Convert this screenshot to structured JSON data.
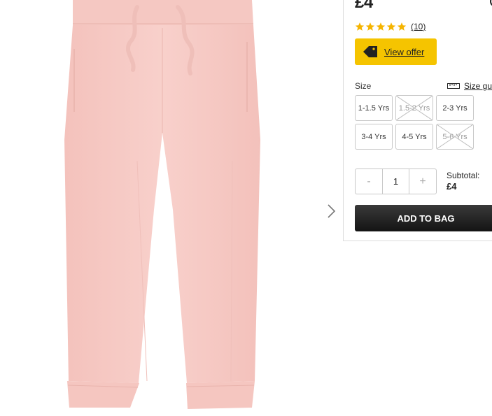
{
  "product": {
    "image_alt": "pink jogger trousers",
    "image_color": "#f6c8c3"
  },
  "panel": {
    "price": "£4",
    "rating": {
      "stars": 5,
      "review_count": "(10)"
    },
    "offer_button": {
      "label": "View offer",
      "color": "#f5c400"
    },
    "size_label": "Size",
    "size_guide_label": "Size guide",
    "sizes": [
      {
        "label": "1-1.5 Yrs",
        "available": true
      },
      {
        "label": "1.5-2 Yrs",
        "available": false
      },
      {
        "label": "2-3 Yrs",
        "available": true
      },
      {
        "label": "3-4 Yrs",
        "available": true
      },
      {
        "label": "4-5 Yrs",
        "available": true
      },
      {
        "label": "5-6 Yrs",
        "available": false
      }
    ],
    "quantity": {
      "minus": "-",
      "value": "1",
      "plus": "+"
    },
    "subtotal_label": "Subtotal:",
    "subtotal_value": "£4",
    "add_to_bag_label": "ADD TO BAG"
  },
  "icons": [
    "search-icon",
    "star-icon",
    "price-tag-icon",
    "ruler-icon",
    "chevron-right-icon"
  ]
}
